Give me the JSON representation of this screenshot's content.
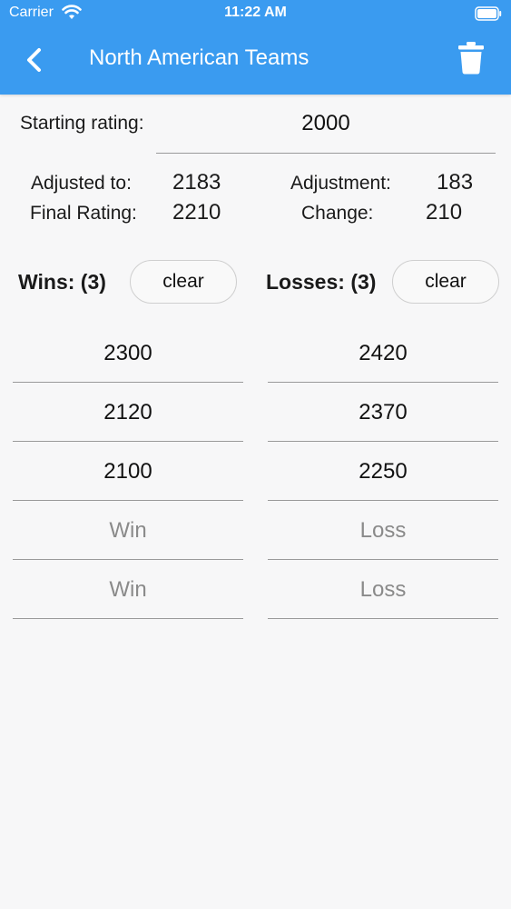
{
  "status_bar": {
    "carrier": "Carrier",
    "time": "11:22 AM"
  },
  "nav": {
    "title": "North American Teams"
  },
  "starting_rating": {
    "label": "Starting rating:",
    "value": "2000"
  },
  "summary": {
    "adjusted_to_label": "Adjusted to:",
    "adjusted_to_value": "2183",
    "adjustment_label": "Adjustment:",
    "adjustment_value": "183",
    "final_rating_label": "Final Rating:",
    "final_rating_value": "2210",
    "change_label": "Change:",
    "change_value": "210"
  },
  "wins": {
    "title": "Wins: (3)",
    "clear_label": "clear",
    "entries": [
      "2300",
      "2120",
      "2100"
    ],
    "placeholders": [
      "Win",
      "Win"
    ]
  },
  "losses": {
    "title": "Losses: (3)",
    "clear_label": "clear",
    "entries": [
      "2420",
      "2370",
      "2250"
    ],
    "placeholders": [
      "Loss",
      "Loss"
    ]
  },
  "colors": {
    "header": "#3a9bf0",
    "background": "#f7f7f8"
  }
}
